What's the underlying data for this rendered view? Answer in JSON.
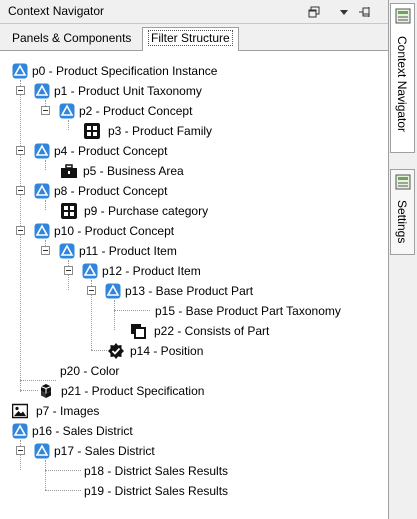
{
  "window": {
    "title": "Context Navigator"
  },
  "tabs": [
    {
      "label": "Panels & Components"
    },
    {
      "label": "Filter Structure"
    }
  ],
  "tree": [
    {
      "label": "p0 - Product Specification Instance",
      "icon": "concept-icon"
    },
    {
      "label": "p1 - Product Unit Taxonomy",
      "icon": "concept-icon"
    },
    {
      "label": "p2 - Product Concept",
      "icon": "concept-icon"
    },
    {
      "label": "p3 - Product Family",
      "icon": "grid-icon"
    },
    {
      "label": "p4 - Product Concept",
      "icon": "concept-icon"
    },
    {
      "label": "p5 - Business Area",
      "icon": "briefcase-icon"
    },
    {
      "label": "p8 - Product Concept",
      "icon": "concept-icon"
    },
    {
      "label": "p9 - Purchase category",
      "icon": "grid-icon"
    },
    {
      "label": "p10 - Product Concept",
      "icon": "concept-icon"
    },
    {
      "label": "p11 - Product Item",
      "icon": "concept-icon"
    },
    {
      "label": "p12 - Product Item",
      "icon": "concept-icon"
    },
    {
      "label": "p13 - Base Product Part",
      "icon": "concept-icon"
    },
    {
      "label": "p15 - Base Product Part Taxonomy",
      "icon": ""
    },
    {
      "label": "p22 - Consists of Part",
      "icon": "copy-icon"
    },
    {
      "label": "p14 - Position",
      "icon": "gear-check-icon"
    },
    {
      "label": "p20 - Color",
      "icon": ""
    },
    {
      "label": "p21 - Product Specification",
      "icon": "cubes-icon"
    },
    {
      "label": "p7 - Images",
      "icon": "image-icon"
    },
    {
      "label": "p16 - Sales District",
      "icon": "concept-icon"
    },
    {
      "label": "p17 - Sales District",
      "icon": "concept-icon"
    },
    {
      "label": "p18 - District Sales Results",
      "icon": ""
    },
    {
      "label": "p19 - District Sales Results",
      "icon": ""
    }
  ],
  "side_tabs": [
    {
      "label": "Context Navigator"
    },
    {
      "label": "Settings"
    }
  ],
  "colors": {
    "concept_icon_bg": "#2f86dc",
    "tree_line": "#9a9a9a",
    "chrome_bg": "#f0f0f0"
  }
}
